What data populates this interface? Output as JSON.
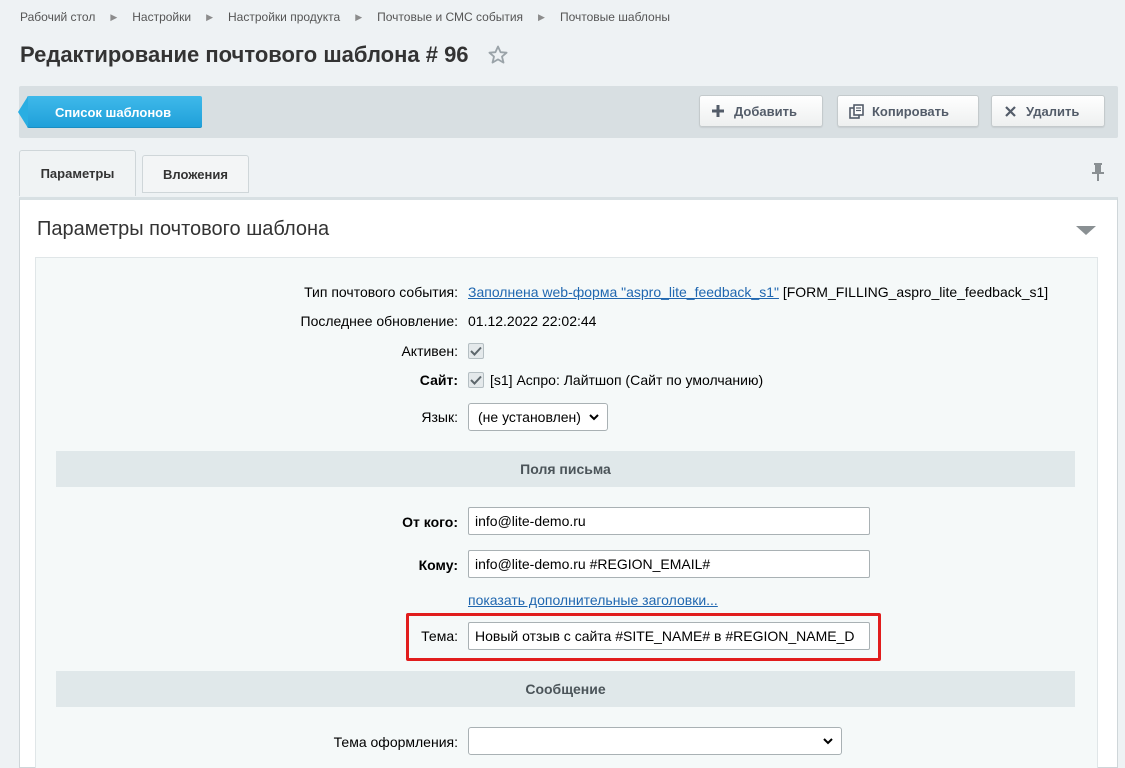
{
  "breadcrumbs": [
    "Рабочий стол",
    "Настройки",
    "Настройки продукта",
    "Почтовые и СМС события",
    "Почтовые шаблоны"
  ],
  "page_title": "Редактирование почтового шаблона # 96",
  "toolbar": {
    "list_label": "Список шаблонов",
    "add_label": "Добавить",
    "copy_label": "Копировать",
    "delete_label": "Удалить"
  },
  "tabs": [
    {
      "label": "Параметры",
      "active": true
    },
    {
      "label": "Вложения",
      "active": false
    }
  ],
  "section_title": "Параметры почтового шаблона",
  "fields": {
    "event_type": {
      "label": "Тип почтового события:",
      "link_text": "Заполнена web-форма \"aspro_lite_feedback_s1\"",
      "code": "[FORM_FILLING_aspro_lite_feedback_s1]"
    },
    "last_update": {
      "label": "Последнее обновление:",
      "value": "01.12.2022 22:02:44"
    },
    "active": {
      "label": "Активен:",
      "checked": true
    },
    "site": {
      "label": "Сайт:",
      "checked": true,
      "value": "[s1] Аспро: Лайтшоп (Сайт по умолчанию)"
    },
    "language": {
      "label": "Язык:",
      "value": "(не установлен)"
    }
  },
  "mail_fields": {
    "header": "Поля письма",
    "from": {
      "label": "От кого:",
      "value": "info@lite-demo.ru"
    },
    "to": {
      "label": "Кому:",
      "value": "info@lite-demo.ru #REGION_EMAIL#"
    },
    "more_headers_link": "показать дополнительные заголовки...",
    "subject": {
      "label": "Тема:",
      "value": "Новый отзыв с сайта #SITE_NAME# в #REGION_NAME_D"
    }
  },
  "message": {
    "header": "Сообщение",
    "theme": {
      "label": "Тема оформления:",
      "value": ""
    }
  },
  "colors": {
    "accent": "#1e9fd9",
    "link": "#2067b0",
    "highlight": "#e11d1d"
  }
}
